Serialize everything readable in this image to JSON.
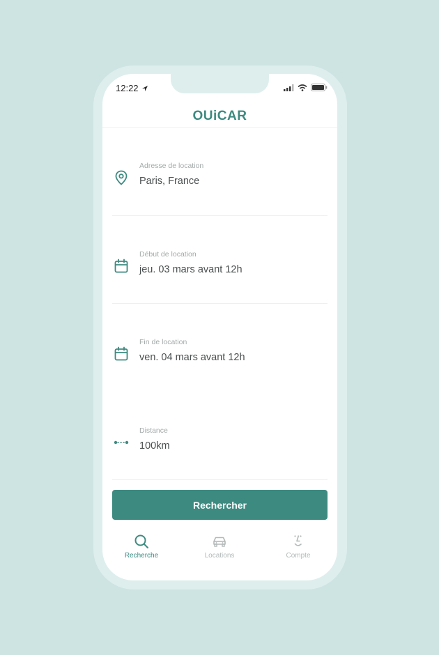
{
  "status_bar": {
    "time": "12:22"
  },
  "header": {
    "logo": "OUiCAR"
  },
  "fields": [
    {
      "icon": "location-pin-icon",
      "label": "Adresse de location",
      "value": "Paris, France"
    },
    {
      "icon": "calendar-icon",
      "label": "Début de location",
      "value": "jeu. 03 mars avant 12h"
    },
    {
      "icon": "calendar-icon",
      "label": "Fin de location",
      "value": "ven. 04 mars avant 12h"
    },
    {
      "icon": "distance-icon",
      "label": "Distance",
      "value": "100km"
    }
  ],
  "search_button": {
    "label": "Rechercher"
  },
  "tabs": [
    {
      "icon": "search-icon",
      "label": "Recherche",
      "active": true
    },
    {
      "icon": "car-icon",
      "label": "Locations",
      "active": false
    },
    {
      "icon": "smile-face-icon",
      "label": "Compte",
      "active": false
    }
  ],
  "colors": {
    "accent": "#3d8a80",
    "background": "#cde4e3",
    "inactive": "#b3b8b8"
  }
}
